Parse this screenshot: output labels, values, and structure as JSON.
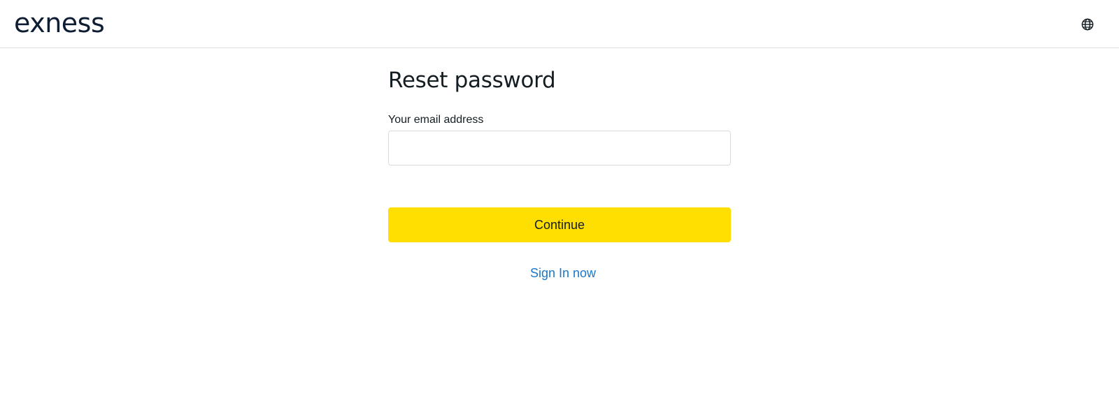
{
  "header": {
    "logo_text": "exness",
    "language_icon": "globe-icon"
  },
  "main": {
    "title": "Reset password",
    "email_label": "Your email address",
    "email_value": "",
    "email_placeholder": "",
    "continue_label": "Continue",
    "signin_label": "Sign In now"
  },
  "colors": {
    "accent": "#ffde02",
    "link": "#1a77c9",
    "text": "#141d22",
    "border": "#d8dadc"
  }
}
